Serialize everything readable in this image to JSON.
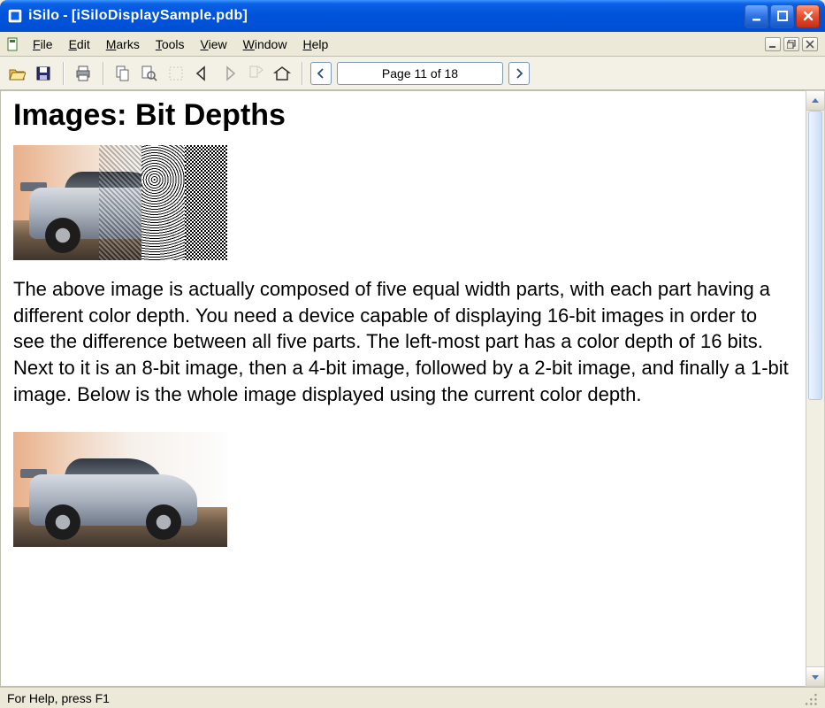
{
  "title": {
    "app": "iSilo",
    "sep": " - ",
    "doc": "[iSiloDisplaySample.pdb]"
  },
  "menus": {
    "file": "File",
    "edit": "Edit",
    "marks": "Marks",
    "tools": "Tools",
    "view": "View",
    "window": "Window",
    "help": "Help"
  },
  "pager": {
    "label": "Page 11 of 18"
  },
  "doc": {
    "heading": "Images: Bit Depths",
    "body": "The above image is actually composed of five equal width parts, with each part having a different color depth. You need a device capable of displaying 16-bit images in order to see the difference between all five parts. The left-most part has a color depth of 16 bits. Next to it is an 8-bit image, then a 4-bit image, followed by a 2-bit image, and finally a 1-bit image. Below is the whole image displayed using the current color depth."
  },
  "status": {
    "help": "For Help, press F1"
  }
}
